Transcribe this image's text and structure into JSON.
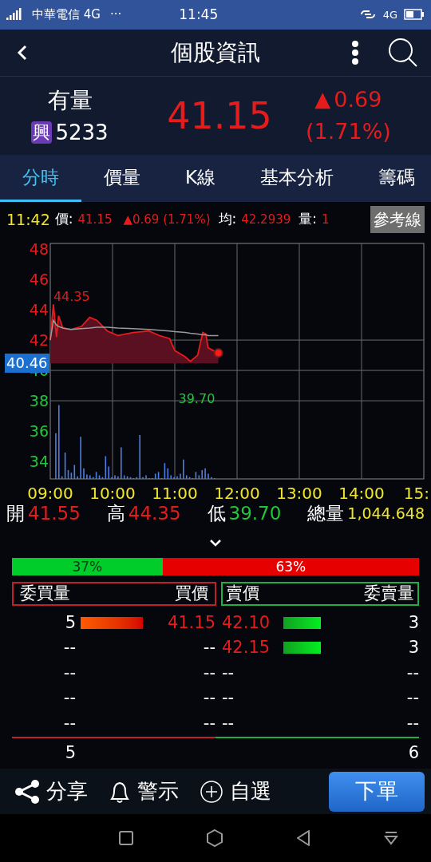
{
  "status_bar": {
    "carrier": "中華電信 4G",
    "more": "···",
    "time": "11:45",
    "network": "4G"
  },
  "header": {
    "title": "個股資訊"
  },
  "quote": {
    "name": "有量",
    "market_badge": "興",
    "code": "5233",
    "price": "41.15",
    "change_sign": "▲",
    "change": "0.69",
    "change_pct": "(1.71%)"
  },
  "tabs": [
    {
      "label": "分時",
      "selected": true
    },
    {
      "label": "價量",
      "selected": false
    },
    {
      "label": "K線",
      "selected": false
    },
    {
      "label": "基本分析",
      "selected": false
    },
    {
      "label": "籌碼",
      "selected": false
    }
  ],
  "info_line": {
    "time": "11:42",
    "price_label": "價:",
    "price": "41.15",
    "change": "▲0.69 (1.71%)",
    "avg_label": "均:",
    "avg": "42.2939",
    "volume_label": "量:",
    "volume": "1",
    "reference_button": "參考線"
  },
  "chart": {
    "reference": "40.46",
    "chart_data": {
      "type": "line",
      "grid": true,
      "xlim": [
        9,
        15
      ],
      "ylim": [
        32.85,
        48.37
      ],
      "xticks": [
        {
          "value": 9,
          "label": "09:00"
        },
        {
          "value": 10,
          "label": "10:00"
        },
        {
          "value": 11,
          "label": "11:00"
        },
        {
          "value": 12,
          "label": "12:00"
        },
        {
          "value": 13,
          "label": "13:00"
        },
        {
          "value": 14,
          "label": "14:00"
        },
        {
          "value": 15,
          "label": "15:"
        }
      ],
      "yticks": [
        34,
        36,
        38,
        40,
        42,
        44,
        46,
        48
      ],
      "x": [
        9,
        9.05,
        9.1,
        9.133,
        9.2,
        9.333,
        9.5,
        9.633,
        9.75,
        9.917,
        10.083,
        10.333,
        10.583,
        10.75,
        10.917,
        11,
        11.167,
        11.25,
        11.367,
        11.45,
        11.5,
        11.533,
        11.667,
        11.7
      ],
      "series": [
        {
          "color": "#e81b1b",
          "values": [
            42.0,
            44.35,
            42.2,
            43.6,
            42.8,
            42.7,
            42.9,
            43.5,
            43.3,
            42.6,
            42.3,
            42.5,
            42.6,
            42.3,
            42.1,
            41.3,
            40.9,
            40.6,
            41.0,
            42.5,
            42.4,
            41.5,
            41.2,
            41.15
          ]
        },
        {
          "color": "#9a9a9a",
          "values": [
            42.0,
            43.3,
            43.0,
            42.9,
            42.8,
            42.7,
            42.75,
            42.8,
            42.85,
            42.85,
            42.8,
            42.75,
            42.7,
            42.65,
            42.6,
            42.55,
            42.5,
            42.45,
            42.4,
            42.35,
            42.35,
            42.3,
            42.3,
            42.29
          ]
        }
      ],
      "annotations": [
        {
          "text": "44.35"
        },
        {
          "text": "39.70"
        }
      ]
    }
  },
  "summary": [
    {
      "label": "開",
      "value": "41.55",
      "color": "#e51c1c"
    },
    {
      "label": "高",
      "value": "44.35",
      "color": "#e51c1c"
    },
    {
      "label": "低",
      "value": "39.70",
      "color": "#1fc83a"
    },
    {
      "label": "總量",
      "value": "1,044.648",
      "color": "#f0e52c"
    }
  ],
  "ratio": {
    "buy": "37%",
    "sell": "63%",
    "level": 0.37
  },
  "order_book": {
    "headers": {
      "bid_qty": "委買量",
      "bid_price": "買價",
      "ask_price": "賣價",
      "ask_qty": "委賣量"
    },
    "rows": [
      {
        "bid": {
          "qty": "5",
          "price": "41.15"
        },
        "ask": {
          "price": "42.10",
          "qty": "3"
        }
      },
      {
        "bid": {
          "qty": "--",
          "price": "--"
        },
        "ask": {
          "price": "42.15",
          "qty": "3"
        }
      },
      {
        "bid": {
          "qty": "--",
          "price": "--"
        },
        "ask": {
          "price": "--",
          "qty": "--"
        }
      },
      {
        "bid": {
          "qty": "--",
          "price": "--"
        },
        "ask": {
          "price": "--",
          "qty": "--"
        }
      },
      {
        "bid": {
          "qty": "--",
          "price": "--"
        },
        "ask": {
          "price": "--",
          "qty": "--"
        }
      }
    ],
    "bid_total": "5",
    "ask_total": "6"
  },
  "bottom_bar": {
    "actions": [
      {
        "kind": "share",
        "label": "分享"
      },
      {
        "kind": "alert",
        "label": "警示"
      },
      {
        "kind": "watch",
        "label": "自選"
      }
    ],
    "order_button": "下單"
  }
}
